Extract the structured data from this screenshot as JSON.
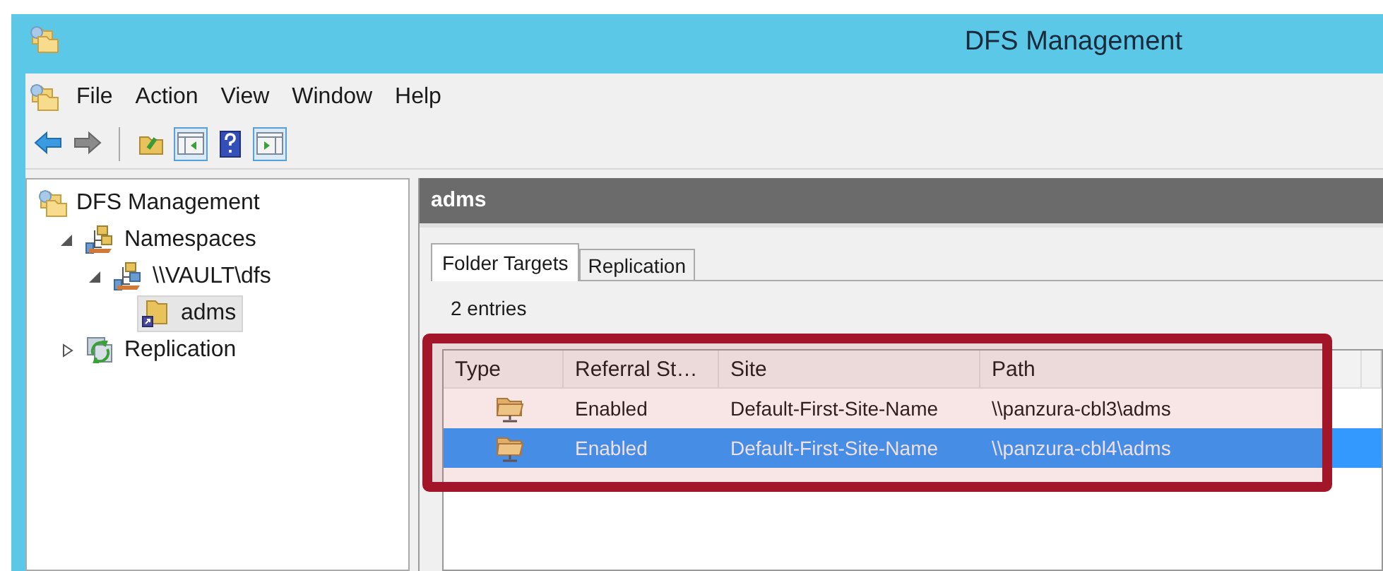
{
  "window": {
    "title": "DFS Management"
  },
  "menu": [
    "File",
    "Action",
    "View",
    "Window",
    "Help"
  ],
  "toolbar": [
    {
      "kind": "back"
    },
    {
      "kind": "forward"
    },
    {
      "kind": "separator"
    },
    {
      "kind": "up"
    },
    {
      "kind": "tree-pane",
      "pressed": true
    },
    {
      "kind": "help"
    },
    {
      "kind": "action-pane",
      "pressed": true
    }
  ],
  "tree": [
    {
      "label": "DFS Management",
      "kind": "root",
      "selected": false,
      "children": [
        {
          "label": "Namespaces",
          "kind": "namespaces",
          "expanded": true,
          "selected": false,
          "children": [
            {
              "label": "\\\\VAULT\\dfs",
              "kind": "namespace",
              "expanded": true,
              "selected": false,
              "children": [
                {
                  "label": "adms",
                  "kind": "folder",
                  "selected": true
                }
              ]
            }
          ]
        },
        {
          "label": "Replication",
          "kind": "replication",
          "expanded": false,
          "selected": false
        }
      ]
    }
  ],
  "pane": {
    "title": "adms",
    "tabs": [
      {
        "label": "Folder Targets",
        "selected": true
      },
      {
        "label": "Replication",
        "selected": false
      }
    ],
    "entries": "2 entries",
    "table": {
      "columns": [
        "Type",
        "Referral St…",
        "Site",
        "Path"
      ],
      "rows": [
        {
          "cells": [
            "",
            "Enabled",
            "Default-First-Site-Name",
            "\\\\panzura-cbl3\\adms"
          ],
          "selected": false
        },
        {
          "cells": [
            "",
            "Enabled",
            "Default-First-Site-Name",
            "\\\\panzura-cbl4\\adms"
          ],
          "selected": true
        }
      ]
    },
    "highlighted": true
  }
}
